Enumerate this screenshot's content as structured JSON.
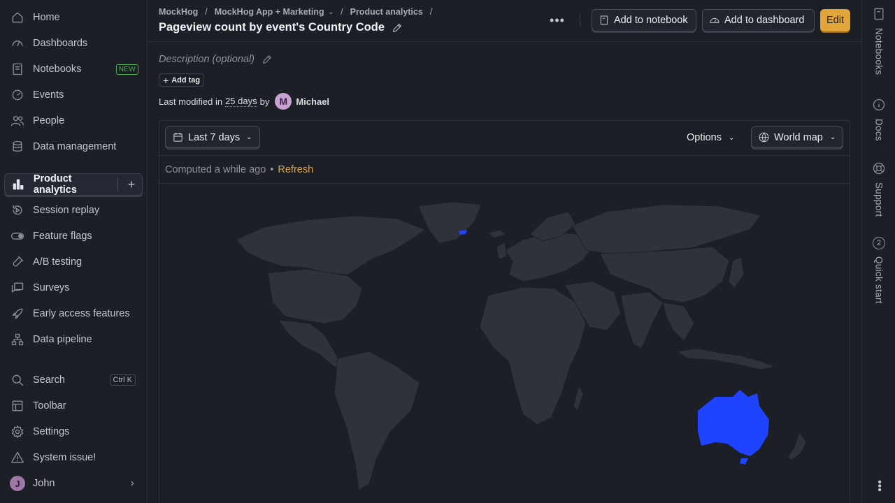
{
  "sidebar": {
    "items": [
      {
        "label": "Home",
        "icon": "home-icon"
      },
      {
        "label": "Dashboards",
        "icon": "dashboard-icon"
      },
      {
        "label": "Notebooks",
        "icon": "notebook-icon",
        "badge": "NEW"
      },
      {
        "label": "Events",
        "icon": "events-icon"
      },
      {
        "label": "People",
        "icon": "people-icon"
      },
      {
        "label": "Data management",
        "icon": "database-icon"
      },
      {
        "label": "Product analytics",
        "icon": "bar-chart-icon",
        "active": true
      },
      {
        "label": "Session replay",
        "icon": "replay-icon"
      },
      {
        "label": "Feature flags",
        "icon": "toggle-icon"
      },
      {
        "label": "A/B testing",
        "icon": "flask-icon"
      },
      {
        "label": "Surveys",
        "icon": "survey-icon"
      },
      {
        "label": "Early access features",
        "icon": "rocket-icon"
      },
      {
        "label": "Data pipeline",
        "icon": "pipeline-icon"
      }
    ],
    "bottom": [
      {
        "label": "Search",
        "icon": "search-icon",
        "shortcut": "Ctrl K"
      },
      {
        "label": "Toolbar",
        "icon": "toolbar-icon"
      },
      {
        "label": "Settings",
        "icon": "gear-icon"
      },
      {
        "label": "System issue!",
        "icon": "warning-icon"
      },
      {
        "label": "John",
        "avatar": "J"
      }
    ]
  },
  "header": {
    "breadcrumbs": [
      "MockHog",
      "MockHog App + Marketing",
      "Product analytics"
    ],
    "title": "Pageview count by event's Country Code",
    "add_to_notebook": "Add to notebook",
    "add_to_dashboard": "Add to dashboard",
    "edit": "Edit"
  },
  "insight": {
    "description_placeholder": "Description (optional)",
    "add_tag": "Add tag",
    "modified_prefix": "Last modified",
    "modified_in": "in",
    "modified_days": "25 days",
    "modified_by": "by",
    "user_initial": "M",
    "user_name": "Michael",
    "date_range": "Last 7 days",
    "options": "Options",
    "display": "World map",
    "computed": "Computed a while ago",
    "refresh": "Refresh"
  },
  "rail": {
    "notebooks": "Notebooks",
    "docs": "Docs",
    "support": "Support",
    "quick_start": "Quick start",
    "quick_start_count": "2"
  },
  "colors": {
    "accent": "#e2a53a",
    "map_land": "#30323b",
    "map_highlight": "#1f43ff",
    "background": "#1d1f27"
  }
}
